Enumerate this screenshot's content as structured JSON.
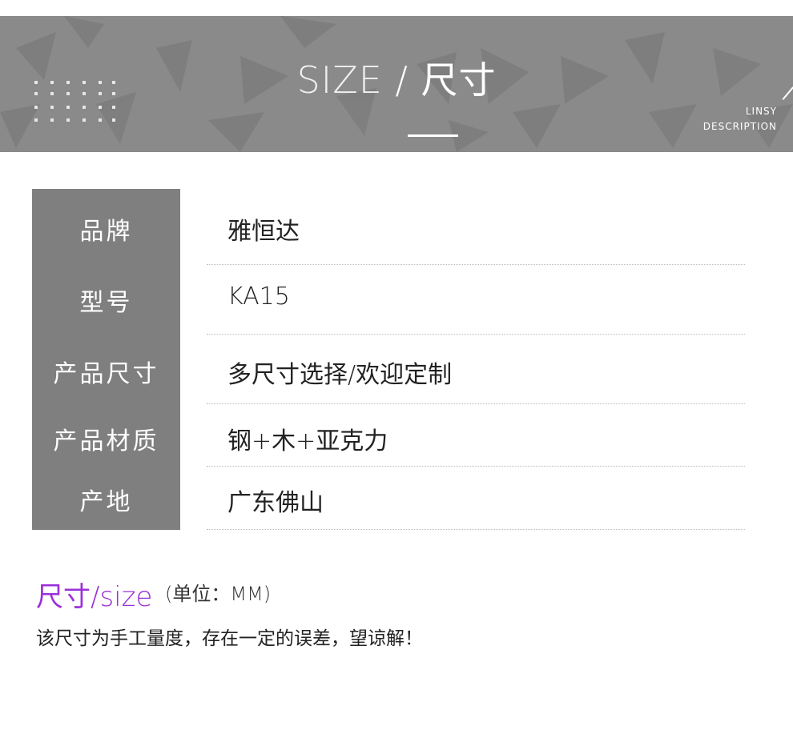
{
  "banner": {
    "title_en": "SIZE",
    "title_sep": "/",
    "title_cn": "尺寸",
    "brand_line1": "LINSY",
    "brand_line2": "DESCRIPTION"
  },
  "specs": [
    {
      "label": "品牌",
      "value": "雅恒达"
    },
    {
      "label": "型号",
      "value": "KA15"
    },
    {
      "label": "产品尺寸",
      "value": "多尺寸选择/欢迎定制"
    },
    {
      "label": "产品材质",
      "value": "钢+木+亚克力"
    },
    {
      "label": "产地",
      "value": "广东佛山"
    }
  ],
  "size_section": {
    "heading": "尺寸/size",
    "unit": "(单位：MM)",
    "note": "该尺寸为手工量度，存在一定的误差，望谅解！"
  },
  "colors": {
    "banner_bg": "#8a8a8a",
    "label_bg": "#7f7f7f",
    "accent_purple": "#9b30d9"
  }
}
